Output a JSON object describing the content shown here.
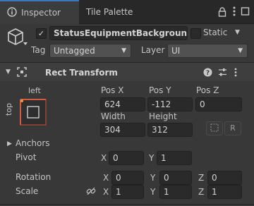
{
  "tabs": [
    {
      "label": "Inspector",
      "icon": "info-icon"
    },
    {
      "label": "Tile Palette"
    }
  ],
  "gameobject": {
    "name": "StatusEquipmentBackground",
    "static_label": "Static",
    "tag_label": "Tag",
    "tag_value": "Untagged",
    "layer_label": "Layer",
    "layer_value": "UI"
  },
  "component": {
    "title": "Rect Transform"
  },
  "anchor_preset": {
    "horizontal": "left",
    "vertical": "top"
  },
  "rect": {
    "pos_x_label": "Pos X",
    "pos_y_label": "Pos Y",
    "pos_z_label": "Pos Z",
    "pos_x": "624",
    "pos_y": "-112",
    "pos_z": "0",
    "width_label": "Width",
    "height_label": "Height",
    "width": "304",
    "height": "312",
    "r_button": "R"
  },
  "anchors_label": "Anchors",
  "pivot": {
    "label": "Pivot",
    "x_label": "X",
    "x": "0",
    "y_label": "Y",
    "y": "1"
  },
  "rotation": {
    "label": "Rotation",
    "x_label": "X",
    "x": "0",
    "y_label": "Y",
    "y": "0",
    "z_label": "Z",
    "z": "0"
  },
  "scale": {
    "label": "Scale",
    "x_label": "X",
    "x": "1",
    "y_label": "Y",
    "y": "1",
    "z_label": "Z",
    "z": "1"
  },
  "colors": {
    "accent": "#3a79bb",
    "panel": "#383838",
    "field": "#2a2a2a"
  }
}
